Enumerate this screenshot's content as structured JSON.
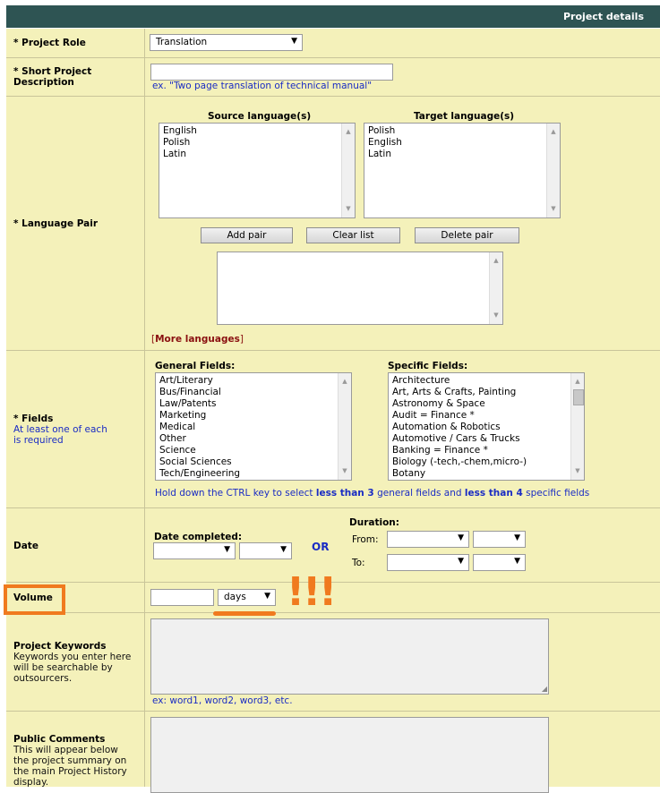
{
  "header": {
    "title": "Project details"
  },
  "project_role": {
    "label": "* Project Role",
    "value": "Translation"
  },
  "short_desc": {
    "label_line1": "* Short Project",
    "label_line2": "Description",
    "value": "",
    "hint": "ex. \"Two page translation of technical manual\""
  },
  "language_pair": {
    "label": "* Language Pair",
    "source_title": "Source language(s)",
    "target_title": "Target language(s)",
    "source_items": [
      "English",
      "Polish",
      "Latin"
    ],
    "target_items": [
      "Polish",
      "English",
      "Latin"
    ],
    "buttons": {
      "add": "Add pair",
      "clear": "Clear list",
      "delete": "Delete pair"
    },
    "more_open": "[",
    "more_link": "More languages",
    "more_close": "]"
  },
  "fields": {
    "label": "* Fields",
    "sub_line1": "At least one of each",
    "sub_line2": "is required",
    "general_title": "General Fields:",
    "specific_title": "Specific Fields:",
    "general_items": [
      "Art/Literary",
      "Bus/Financial",
      "Law/Patents",
      "Marketing",
      "Medical",
      "Other",
      "Science",
      "Social Sciences",
      "Tech/Engineering"
    ],
    "specific_items": [
      "Architecture",
      "Art, Arts & Crafts, Painting",
      "Astronomy & Space",
      "Audit = Finance *",
      "Automation & Robotics",
      "Automotive / Cars & Trucks",
      "Banking = Finance *",
      "Biology (-tech,-chem,micro-)",
      "Botany"
    ],
    "note_a": "Hold down the CTRL key to select ",
    "note_b": "less than 3",
    "note_c": " general fields and ",
    "note_d": "less than 4",
    "note_e": " specific fields"
  },
  "date": {
    "label": "Date",
    "completed_label": "Date completed:",
    "or": "OR",
    "duration_label": "Duration:",
    "from": "From:",
    "to": "To:"
  },
  "volume": {
    "label": "Volume",
    "unit": "days",
    "annotation": "!!!",
    "highlight_color": "#f07a1f"
  },
  "keywords": {
    "label": "Project Keywords",
    "desc_lines": [
      "Keywords you enter here",
      "will be searchable by",
      "outsourcers."
    ],
    "hint": "ex: word1, word2, word3, etc."
  },
  "comments": {
    "label": "Public Comments",
    "desc_lines": [
      "This will appear below",
      "the project summary on",
      "the main Project History",
      "display."
    ]
  }
}
